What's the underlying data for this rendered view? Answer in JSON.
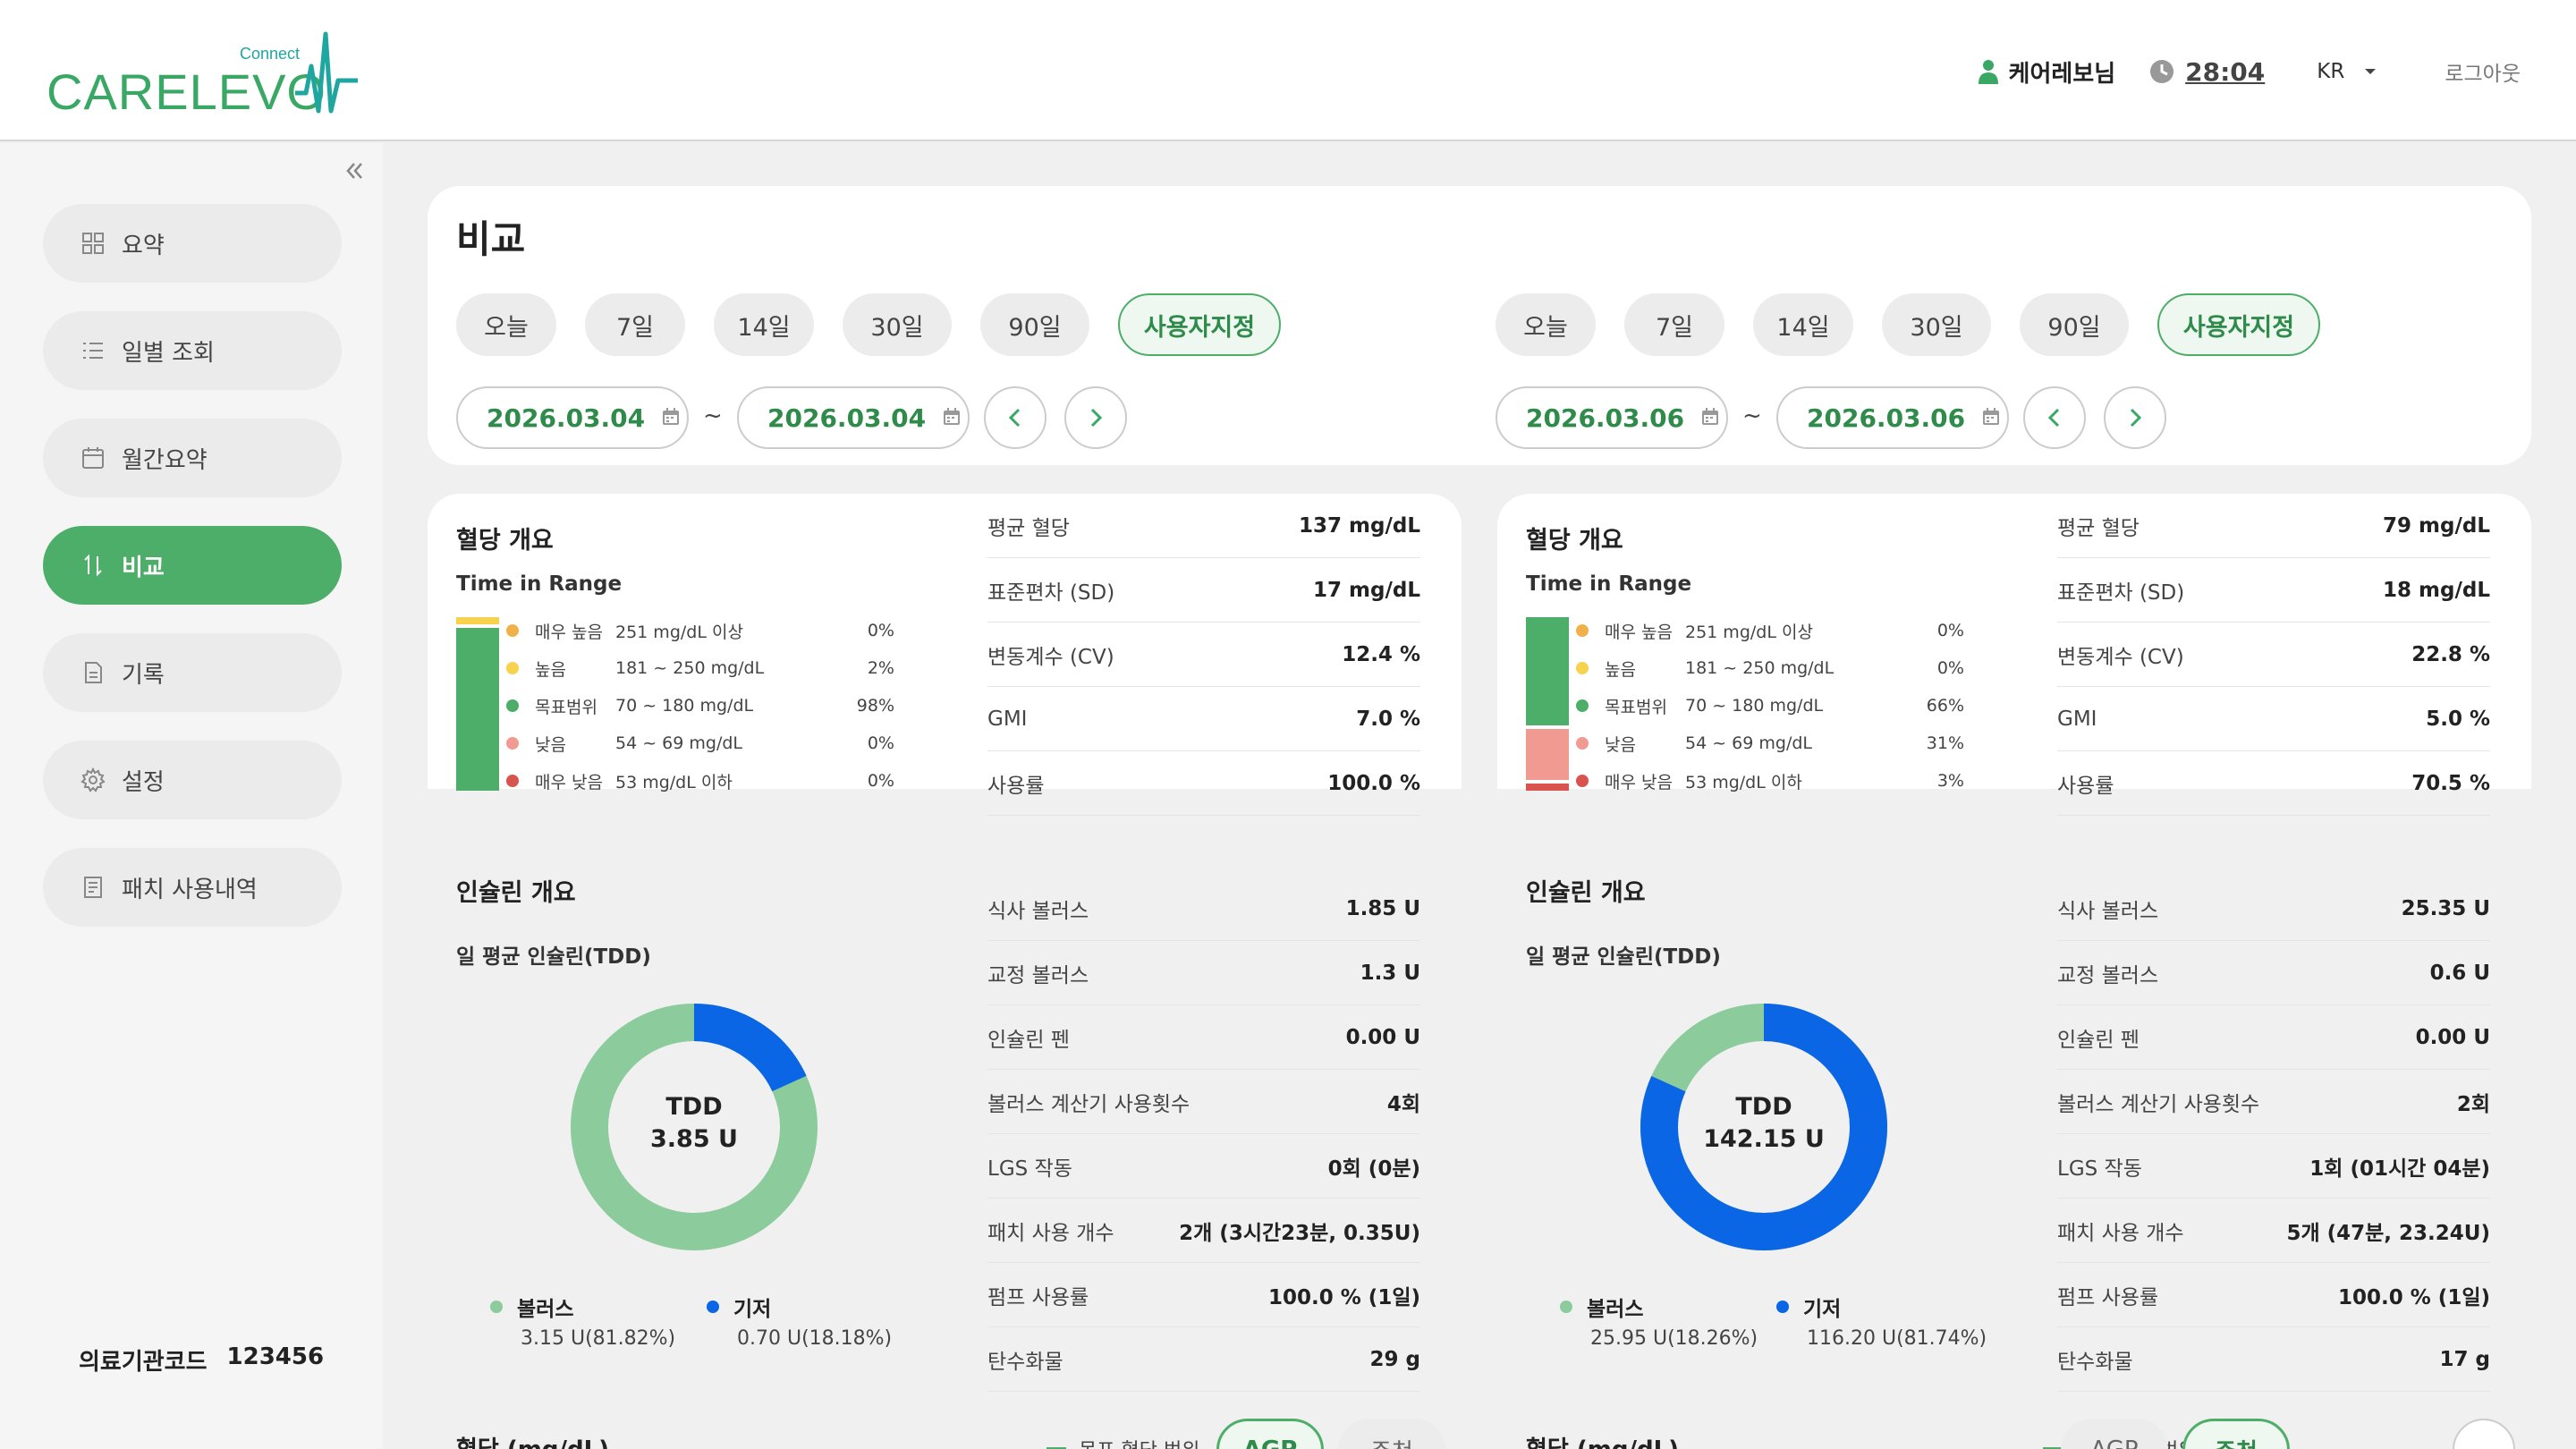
{
  "header": {
    "brand": "CARELEVO",
    "brand_sub": "Connect",
    "user": "케어레보님",
    "timer": "28:04",
    "lang": "KR",
    "logout": "로그아웃"
  },
  "sidebar": {
    "items": [
      {
        "label": "요약",
        "icon": "grid-icon"
      },
      {
        "label": "일별 조회",
        "icon": "list-icon"
      },
      {
        "label": "월간요약",
        "icon": "calendar-icon"
      },
      {
        "label": "비교",
        "icon": "compare-icon"
      },
      {
        "label": "기록",
        "icon": "document-icon"
      },
      {
        "label": "설정",
        "icon": "gear-icon"
      },
      {
        "label": "패치 사용내역",
        "icon": "receipt-icon"
      }
    ],
    "active_index": 3,
    "institution_label": "의료기관코드",
    "institution_code": "123456"
  },
  "page": {
    "title": "비교"
  },
  "compare": [
    {
      "ranges": [
        "오늘",
        "7일",
        "14일",
        "30일",
        "90일",
        "사용자지정"
      ],
      "selected_range": "사용자지정",
      "start": "2026.03.04",
      "end": "2026.03.04",
      "glucose": {
        "title": "혈당 개요",
        "tir_title": "Time in Range",
        "levels": [
          {
            "label": "매우 높음",
            "range": "251 mg/dL 이상",
            "pct": "0%",
            "value": 0,
            "color": "#f0b04a"
          },
          {
            "label": "높음",
            "range": "181 ~ 250 mg/dL",
            "pct": "2%",
            "value": 2,
            "color": "#f6d24e"
          },
          {
            "label": "목표범위",
            "range": "70 ~ 180 mg/dL",
            "pct": "98%",
            "value": 98,
            "color": "#4cae68"
          },
          {
            "label": "낮음",
            "range": "54 ~ 69 mg/dL",
            "pct": "0%",
            "value": 0,
            "color": "#f09a92"
          },
          {
            "label": "매우 낮음",
            "range": "53 mg/dL 이하",
            "pct": "0%",
            "value": 0,
            "color": "#d9534f"
          }
        ],
        "stats": [
          {
            "k": "평균 혈당",
            "v": "137 mg/dL"
          },
          {
            "k": "표준편차 (SD)",
            "v": "17 mg/dL"
          },
          {
            "k": "변동계수 (CV)",
            "v": "12.4 %"
          },
          {
            "k": "GMI",
            "v": "7.0 %"
          },
          {
            "k": "사용률",
            "v": "100.0 %"
          }
        ]
      },
      "insulin": {
        "title": "인슐린 개요",
        "tdd_title": "일 평균 인슐린(TDD)",
        "tdd_label": "TDD",
        "tdd_value": "3.85 U",
        "bolus_frac": 0.8182,
        "bolus": {
          "label": "볼러스",
          "detail": "3.15 U(81.82%)"
        },
        "basal": {
          "label": "기저",
          "detail": "0.70 U(18.18%)"
        },
        "stats": [
          {
            "k": "식사 볼러스",
            "v": "1.85 U"
          },
          {
            "k": "교정 볼러스",
            "v": "1.3 U"
          },
          {
            "k": "인슐린 펜",
            "v": "0.00 U"
          },
          {
            "k": "볼러스 계산기 사용횟수",
            "v": "4회"
          },
          {
            "k": "LGS 작동",
            "v": "0회 (0분)"
          },
          {
            "k": "패치 사용 개수",
            "v": "2개 (3시간23분, 0.35U)"
          },
          {
            "k": "펌프 사용률",
            "v": "100.0 % (1일)"
          },
          {
            "k": "탄수화물",
            "v": "29 g"
          }
        ]
      },
      "bottom": {
        "title": "혈당 (mg/dL)",
        "legend": "목표 혈당 범위",
        "btn1": "AGP",
        "btn2": "주천",
        "active_btn": 1
      }
    },
    {
      "ranges": [
        "오늘",
        "7일",
        "14일",
        "30일",
        "90일",
        "사용자지정"
      ],
      "selected_range": "사용자지정",
      "start": "2026.03.06",
      "end": "2026.03.06",
      "glucose": {
        "title": "혈당 개요",
        "tir_title": "Time in Range",
        "levels": [
          {
            "label": "매우 높음",
            "range": "251 mg/dL 이상",
            "pct": "0%",
            "value": 0,
            "color": "#f0b04a"
          },
          {
            "label": "높음",
            "range": "181 ~ 250 mg/dL",
            "pct": "0%",
            "value": 0,
            "color": "#f6d24e"
          },
          {
            "label": "목표범위",
            "range": "70 ~ 180 mg/dL",
            "pct": "66%",
            "value": 66,
            "color": "#4cae68"
          },
          {
            "label": "낮음",
            "range": "54 ~ 69 mg/dL",
            "pct": "31%",
            "value": 31,
            "color": "#f09a92"
          },
          {
            "label": "매우 낮음",
            "range": "53 mg/dL 이하",
            "pct": "3%",
            "value": 3,
            "color": "#d9534f"
          }
        ],
        "stats": [
          {
            "k": "평균 혈당",
            "v": "79 mg/dL"
          },
          {
            "k": "표준편차 (SD)",
            "v": "18 mg/dL"
          },
          {
            "k": "변동계수 (CV)",
            "v": "22.8 %"
          },
          {
            "k": "GMI",
            "v": "5.0 %"
          },
          {
            "k": "사용률",
            "v": "70.5 %"
          }
        ]
      },
      "insulin": {
        "title": "인슐린 개요",
        "tdd_title": "일 평균 인슐린(TDD)",
        "tdd_label": "TDD",
        "tdd_value": "142.15 U",
        "bolus_frac": 0.1826,
        "bolus": {
          "label": "볼러스",
          "detail": "25.95 U(18.26%)"
        },
        "basal": {
          "label": "기저",
          "detail": "116.20 U(81.74%)"
        },
        "stats": [
          {
            "k": "식사 볼러스",
            "v": "25.35 U"
          },
          {
            "k": "교정 볼러스",
            "v": "0.6 U"
          },
          {
            "k": "인슐린 펜",
            "v": "0.00 U"
          },
          {
            "k": "볼러스 계산기 사용횟수",
            "v": "2회"
          },
          {
            "k": "LGS 작동",
            "v": "1회 (01시간 04분)"
          },
          {
            "k": "패치 사용 개수",
            "v": "5개 (47분, 23.24U)"
          },
          {
            "k": "펌프 사용률",
            "v": "100.0 % (1일)"
          },
          {
            "k": "탄수화물",
            "v": "17 g"
          }
        ]
      },
      "bottom": {
        "title": "혈당 (mg/dL)",
        "legend": "목표 혈당 범위",
        "btn1": "AGP",
        "btn2": "주천",
        "active_btn": 2
      }
    }
  ],
  "colors": {
    "accent": "#4cae68",
    "bolus": "#8ccb9c",
    "basal": "#0a66e4"
  }
}
